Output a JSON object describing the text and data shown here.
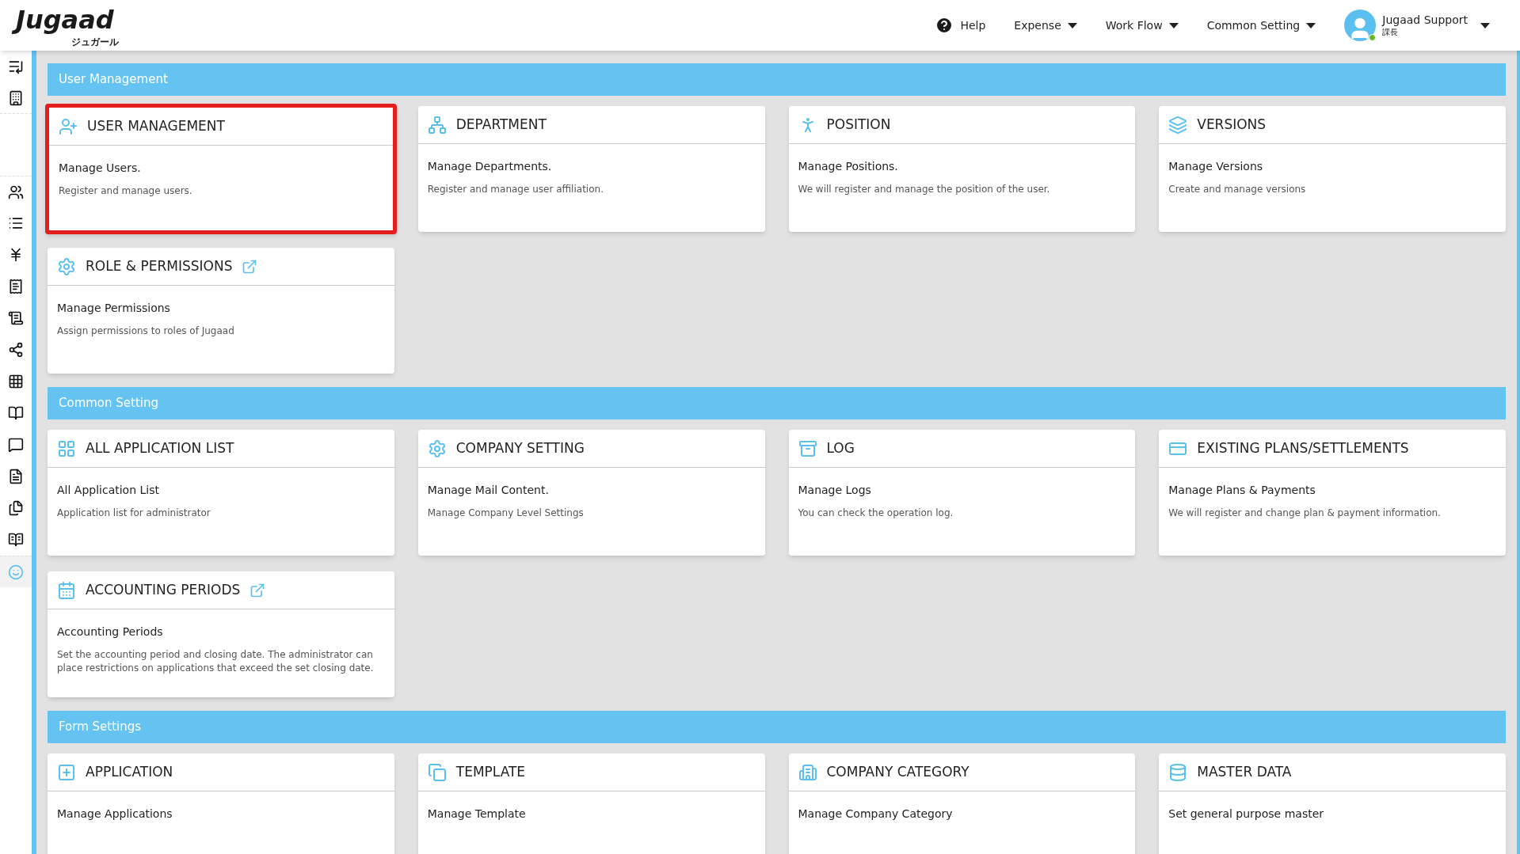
{
  "header": {
    "logo": "Jugaad",
    "logo_sub": "ジュガール",
    "help": "Help",
    "menus": [
      "Expense",
      "Work Flow",
      "Common Setting"
    ],
    "user": {
      "name": "Jugaad Support",
      "role": "課長",
      "online": true
    }
  },
  "sidebar": {
    "items": [
      {
        "selected": false
      },
      {
        "selected": false
      },
      {
        "selected": false
      },
      {
        "selected": false
      },
      {
        "selected": false
      },
      {
        "selected": false
      },
      {
        "selected": false
      },
      {
        "selected": false
      },
      {
        "selected": false
      },
      {
        "selected": false
      },
      {
        "selected": false
      },
      {
        "selected": false
      },
      {
        "selected": false
      },
      {
        "selected": false
      },
      {
        "selected": true
      }
    ]
  },
  "sections": [
    {
      "title": "User Management",
      "cards": [
        {
          "title": "USER MANAGEMENT",
          "subtitle": "Manage Users.",
          "description": "Register and manage users.",
          "highlighted": true,
          "external_link": false
        },
        {
          "title": "DEPARTMENT",
          "subtitle": "Manage Departments.",
          "description": "Register and manage user affiliation.",
          "highlighted": false,
          "external_link": false
        },
        {
          "title": "POSITION",
          "subtitle": "Manage Positions.",
          "description": "We will register and manage the position of the user.",
          "highlighted": false,
          "external_link": false
        },
        {
          "title": "VERSIONS",
          "subtitle": "Manage Versions",
          "description": "Create and manage versions",
          "highlighted": false,
          "external_link": false
        },
        {
          "title": "ROLE & PERMISSIONS",
          "subtitle": "Manage Permissions",
          "description": "Assign permissions to roles of Jugaad",
          "highlighted": false,
          "external_link": true
        }
      ]
    },
    {
      "title": "Common Setting",
      "cards": [
        {
          "title": "ALL APPLICATION LIST",
          "subtitle": "All Application List",
          "description": "Application list for administrator",
          "highlighted": false,
          "external_link": false
        },
        {
          "title": "COMPANY SETTING",
          "subtitle": "Manage Mail Content.",
          "description": "Manage Company Level Settings",
          "highlighted": false,
          "external_link": false
        },
        {
          "title": "LOG",
          "subtitle": "Manage Logs",
          "description": "You can check the operation log.",
          "highlighted": false,
          "external_link": false
        },
        {
          "title": "EXISTING PLANS/SETTLEMENTS",
          "subtitle": "Manage Plans & Payments",
          "description": "We will register and change plan & payment information.",
          "highlighted": false,
          "external_link": false
        },
        {
          "title": "ACCOUNTING PERIODS",
          "subtitle": "Accounting Periods",
          "description": "Set the accounting period and closing date. The administrator can place restrictions on applications that exceed the set closing date.",
          "highlighted": false,
          "external_link": true
        }
      ]
    },
    {
      "title": "Form Settings",
      "cards": [
        {
          "title": "APPLICATION",
          "subtitle": "Manage Applications",
          "highlighted": false,
          "external_link": false
        },
        {
          "title": "TEMPLATE",
          "subtitle": "Manage Template",
          "highlighted": false,
          "external_link": false
        },
        {
          "title": "COMPANY CATEGORY",
          "subtitle": "Manage Company Category",
          "highlighted": false,
          "external_link": false
        },
        {
          "title": "MASTER DATA",
          "subtitle": "Set general purpose master",
          "highlighted": false,
          "external_link": false
        }
      ]
    }
  ]
}
